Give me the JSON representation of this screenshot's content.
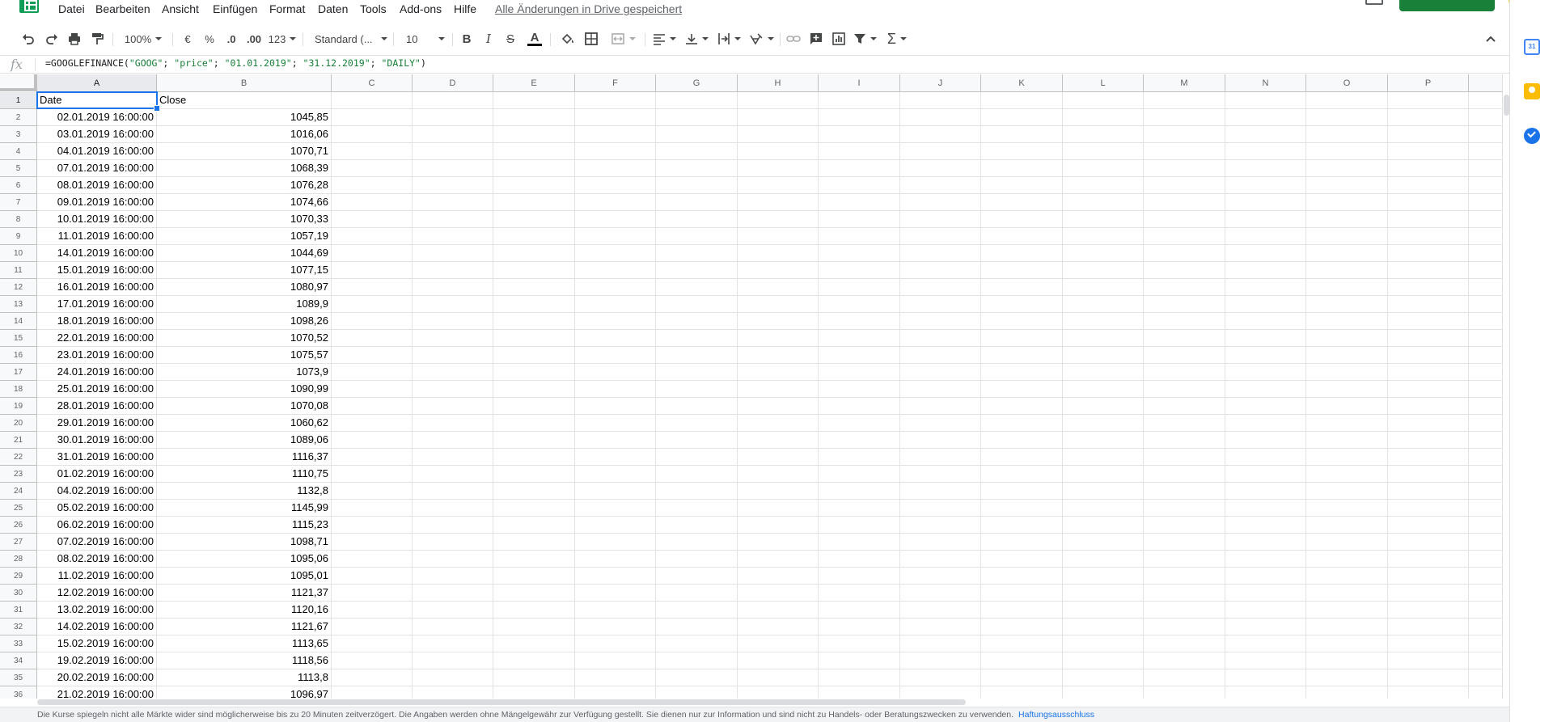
{
  "menu": {
    "items": [
      "Datei",
      "Bearbeiten",
      "Ansicht",
      "Einfügen",
      "Format",
      "Daten",
      "Tools",
      "Add-ons",
      "Hilfe"
    ],
    "save_status": "Alle Änderungen in Drive gespeichert"
  },
  "toolbar": {
    "zoom": "100%",
    "currency": "€",
    "percent": "%",
    "decrease_decimals": ".0",
    "increase_decimals": ".00",
    "more_formats": "123",
    "font": "Standard (...",
    "font_size": "10"
  },
  "formula_bar": {
    "fx": "fx",
    "parts": [
      {
        "t": "=GOOGLEFINANCE(",
        "s": false
      },
      {
        "t": "\"GOOG\"",
        "s": true
      },
      {
        "t": "; ",
        "s": false
      },
      {
        "t": "\"price\"",
        "s": true
      },
      {
        "t": "; ",
        "s": false
      },
      {
        "t": "\"01.01.2019\"",
        "s": true
      },
      {
        "t": "; ",
        "s": false
      },
      {
        "t": "\"31.12.2019\"",
        "s": true
      },
      {
        "t": "; ",
        "s": false
      },
      {
        "t": "\"DAILY\"",
        "s": true
      },
      {
        "t": ")",
        "s": false
      }
    ]
  },
  "columns": [
    "A",
    "B",
    "C",
    "D",
    "E",
    "F",
    "G",
    "H",
    "I",
    "J",
    "K",
    "L",
    "M",
    "N",
    "O",
    "P"
  ],
  "header_row": [
    "Date",
    "Close"
  ],
  "data_rows": [
    [
      "02.01.2019 16:00:00",
      "1045,85"
    ],
    [
      "03.01.2019 16:00:00",
      "1016,06"
    ],
    [
      "04.01.2019 16:00:00",
      "1070,71"
    ],
    [
      "07.01.2019 16:00:00",
      "1068,39"
    ],
    [
      "08.01.2019 16:00:00",
      "1076,28"
    ],
    [
      "09.01.2019 16:00:00",
      "1074,66"
    ],
    [
      "10.01.2019 16:00:00",
      "1070,33"
    ],
    [
      "11.01.2019 16:00:00",
      "1057,19"
    ],
    [
      "14.01.2019 16:00:00",
      "1044,69"
    ],
    [
      "15.01.2019 16:00:00",
      "1077,15"
    ],
    [
      "16.01.2019 16:00:00",
      "1080,97"
    ],
    [
      "17.01.2019 16:00:00",
      "1089,9"
    ],
    [
      "18.01.2019 16:00:00",
      "1098,26"
    ],
    [
      "22.01.2019 16:00:00",
      "1070,52"
    ],
    [
      "23.01.2019 16:00:00",
      "1075,57"
    ],
    [
      "24.01.2019 16:00:00",
      "1073,9"
    ],
    [
      "25.01.2019 16:00:00",
      "1090,99"
    ],
    [
      "28.01.2019 16:00:00",
      "1070,08"
    ],
    [
      "29.01.2019 16:00:00",
      "1060,62"
    ],
    [
      "30.01.2019 16:00:00",
      "1089,06"
    ],
    [
      "31.01.2019 16:00:00",
      "1116,37"
    ],
    [
      "01.02.2019 16:00:00",
      "1110,75"
    ],
    [
      "04.02.2019 16:00:00",
      "1132,8"
    ],
    [
      "05.02.2019 16:00:00",
      "1145,99"
    ],
    [
      "06.02.2019 16:00:00",
      "1115,23"
    ],
    [
      "07.02.2019 16:00:00",
      "1098,71"
    ],
    [
      "08.02.2019 16:00:00",
      "1095,06"
    ],
    [
      "11.02.2019 16:00:00",
      "1095,01"
    ],
    [
      "12.02.2019 16:00:00",
      "1121,37"
    ],
    [
      "13.02.2019 16:00:00",
      "1120,16"
    ],
    [
      "14.02.2019 16:00:00",
      "1121,67"
    ],
    [
      "15.02.2019 16:00:00",
      "1113,65"
    ],
    [
      "19.02.2019 16:00:00",
      "1118,56"
    ],
    [
      "20.02.2019 16:00:00",
      "1113,8"
    ],
    [
      "21.02.2019 16:00:00",
      "1096,97"
    ]
  ],
  "footer": {
    "disclaimer": "Die Kurse spiegeln nicht alle Märkte wider sind möglicherweise bis zu 20 Minuten zeitverzögert. Die Angaben werden ohne Mängelgewähr zur Verfügung gestellt. Sie dienen nur zur Information und sind nicht zu Handels- oder Beratungszwecken zu verwenden.",
    "link": "Haftungsausschluss"
  },
  "side_panel": {
    "calendar_day": "31"
  },
  "colors": {
    "selection": "#1a73e8",
    "formula_string": "#188038",
    "brand": "#0f9d58"
  }
}
